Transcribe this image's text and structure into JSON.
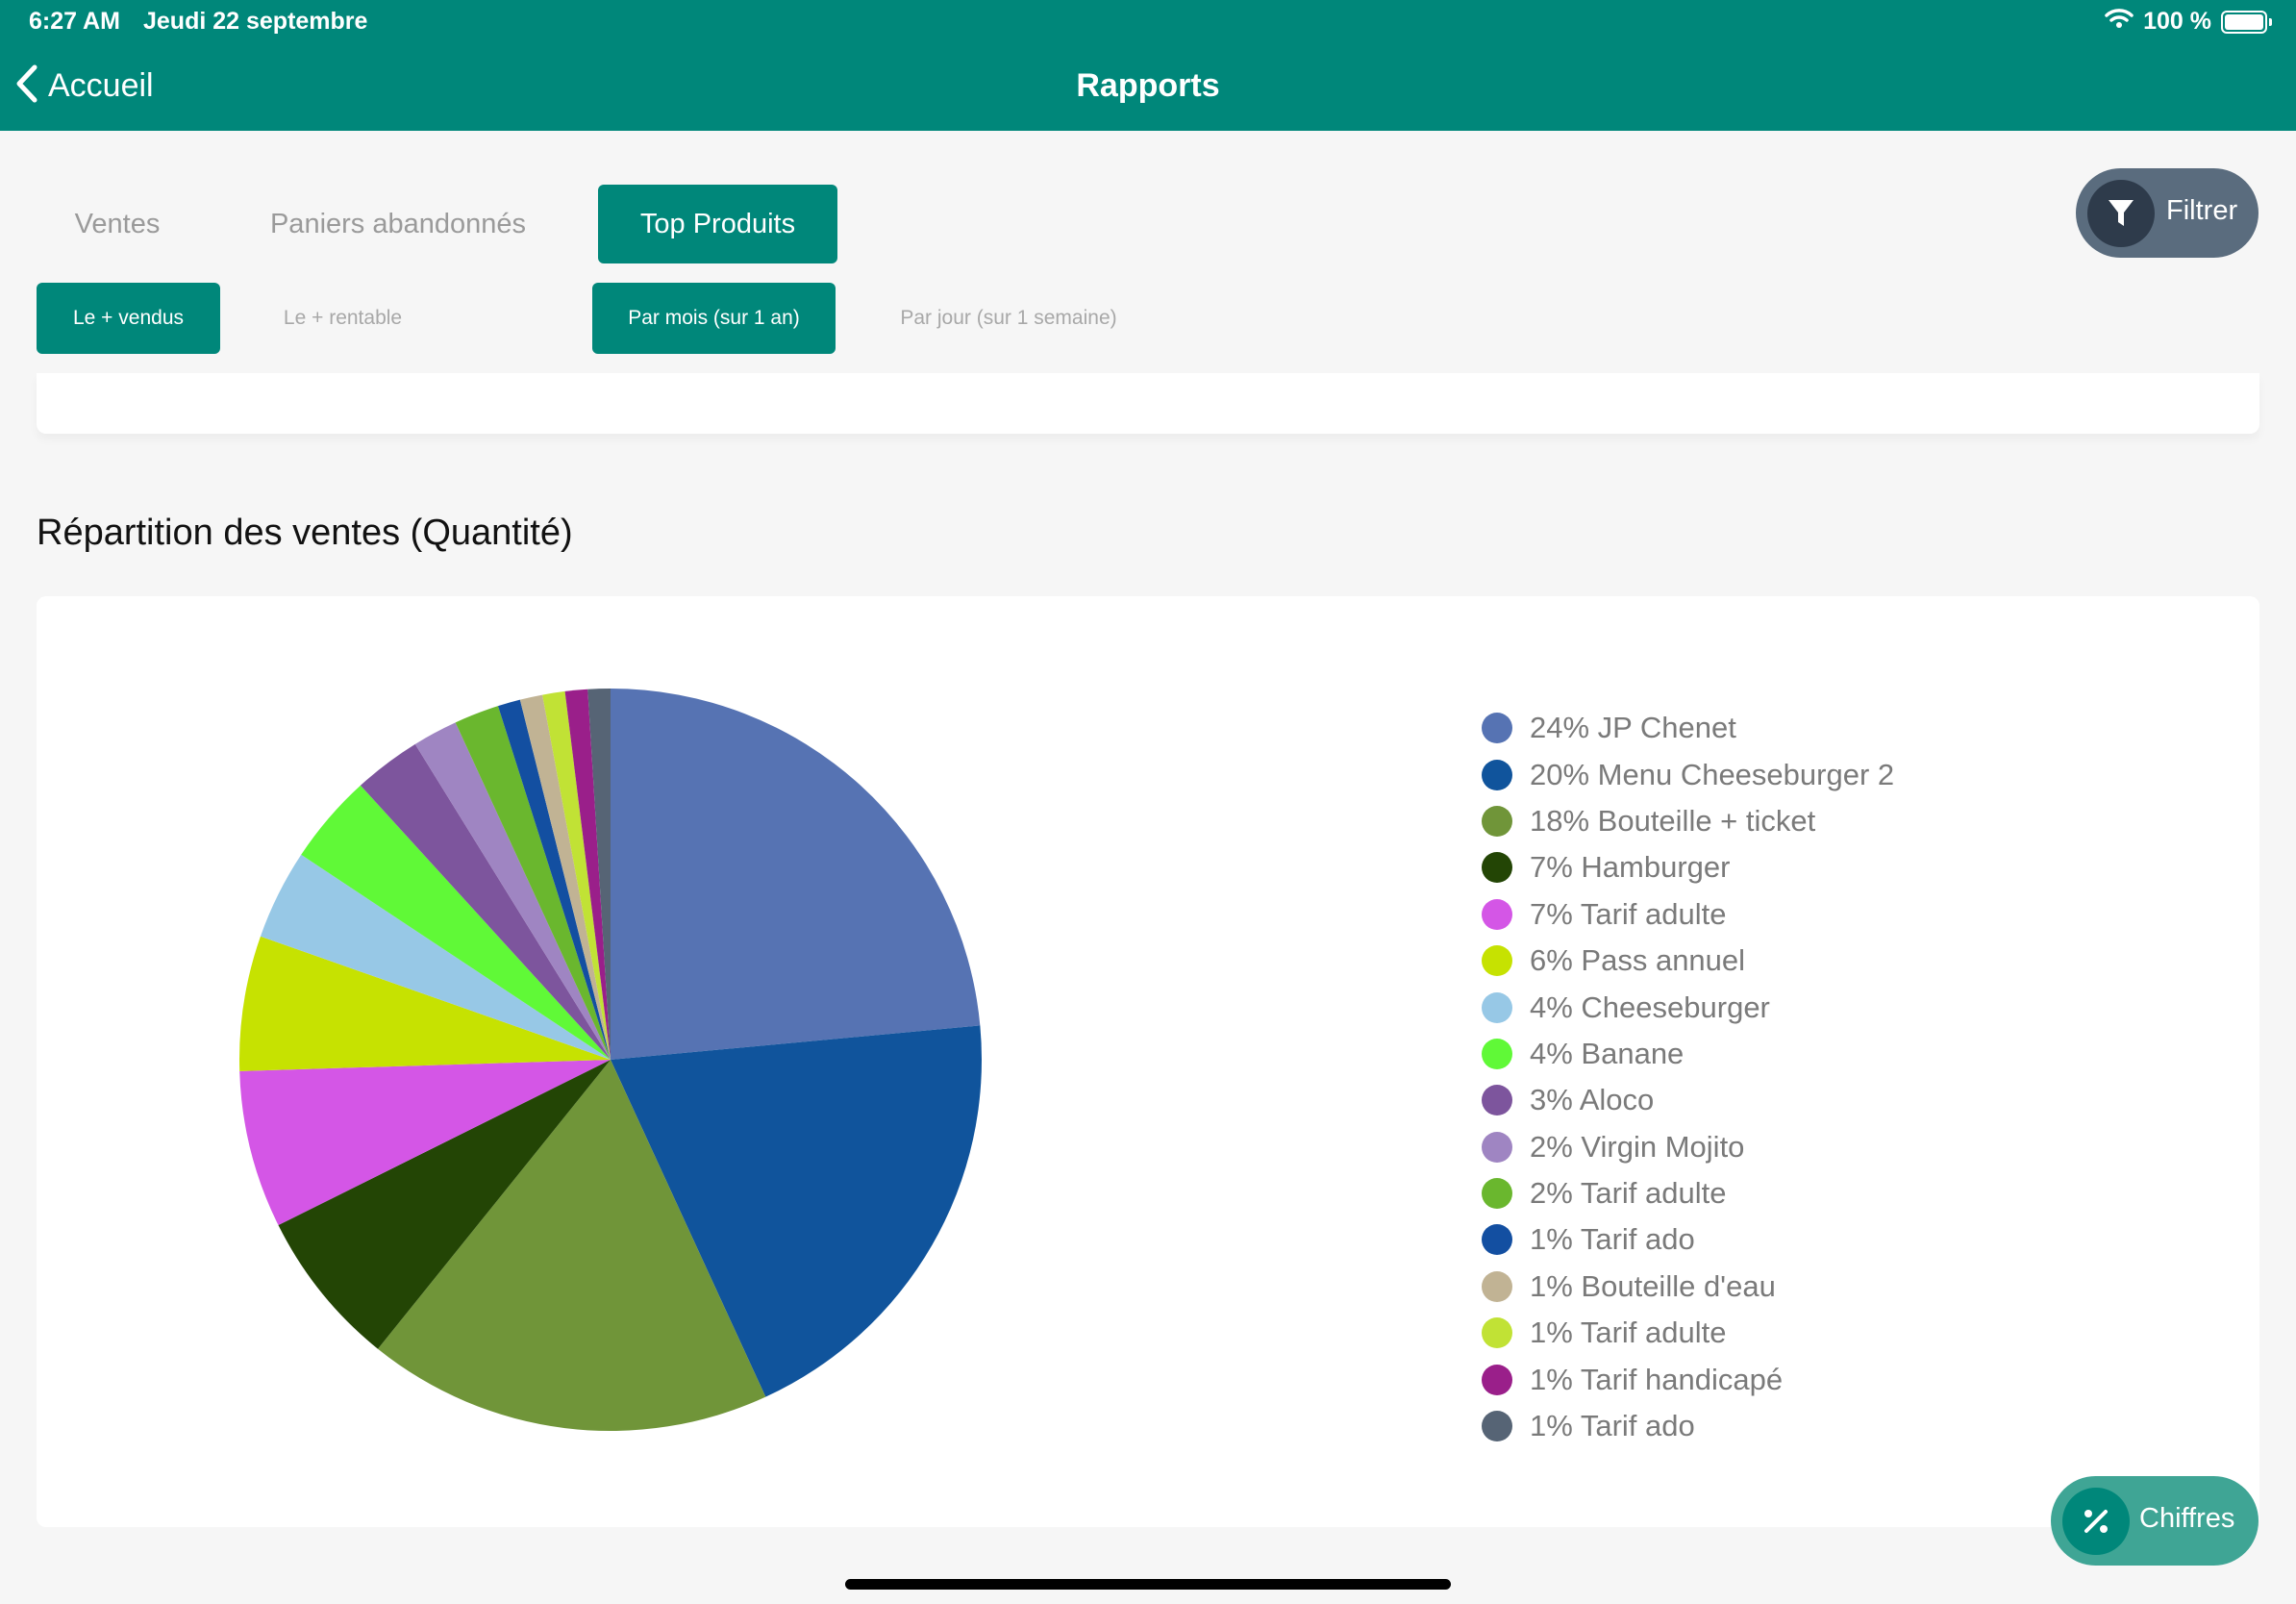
{
  "status": {
    "time": "6:27 AM",
    "date": "Jeudi 22 septembre",
    "battery": "100 %"
  },
  "nav": {
    "back_label": "Accueil",
    "title": "Rapports"
  },
  "tabs": [
    {
      "label": "Ventes",
      "active": false
    },
    {
      "label": "Paniers abandonnés",
      "active": false
    },
    {
      "label": "Top Produits",
      "active": true
    }
  ],
  "subtabs": [
    {
      "label": "Le + vendus",
      "active": true
    },
    {
      "label": "Le + rentable",
      "active": false
    },
    {
      "label": "Par mois (sur 1 an)",
      "active": true
    },
    {
      "label": "Par jour (sur 1 semaine)",
      "active": false
    }
  ],
  "filter": {
    "label": "Filtrer",
    "icon": "filter-icon"
  },
  "section": {
    "title": "Répartition des ventes (Quantité)"
  },
  "chiffres": {
    "label": "Chiffres",
    "icon": "percent-icon"
  },
  "colors": {
    "primary": "#00877a",
    "filter_bg": "#5a6c7e",
    "chiffres_bg": "#3fa595"
  },
  "chart_data": {
    "type": "pie",
    "legend_position": "right",
    "slices": [
      {
        "label": "JP Chenet",
        "percent": 24,
        "color": "#5673b3"
      },
      {
        "label": "Menu Cheeseburger 2",
        "percent": 20,
        "color": "#10549c"
      },
      {
        "label": "Bouteille + ticket",
        "percent": 18,
        "color": "#709539"
      },
      {
        "label": "Hamburger",
        "percent": 7,
        "color": "#234505"
      },
      {
        "label": "Tarif adulte",
        "percent": 7,
        "color": "#d456e6"
      },
      {
        "label": "Pass annuel",
        "percent": 6,
        "color": "#c6e201"
      },
      {
        "label": "Cheeseburger",
        "percent": 4,
        "color": "#97c8e6"
      },
      {
        "label": "Banane",
        "percent": 4,
        "color": "#60f937"
      },
      {
        "label": "Aloco",
        "percent": 3,
        "color": "#7d559d"
      },
      {
        "label": "Virgin Mojito",
        "percent": 2,
        "color": "#9f85c2"
      },
      {
        "label": "Tarif adulte",
        "percent": 2,
        "color": "#6ab72e"
      },
      {
        "label": "Tarif ado",
        "percent": 1,
        "color": "#134fa1"
      },
      {
        "label": "Bouteille d'eau",
        "percent": 1,
        "color": "#c1b394"
      },
      {
        "label": "Tarif adulte",
        "percent": 1,
        "color": "#c1e235"
      },
      {
        "label": "Tarif handicapé",
        "percent": 1,
        "color": "#9a1f8a"
      },
      {
        "label": "Tarif ado",
        "percent": 1,
        "color": "#566475"
      }
    ]
  }
}
